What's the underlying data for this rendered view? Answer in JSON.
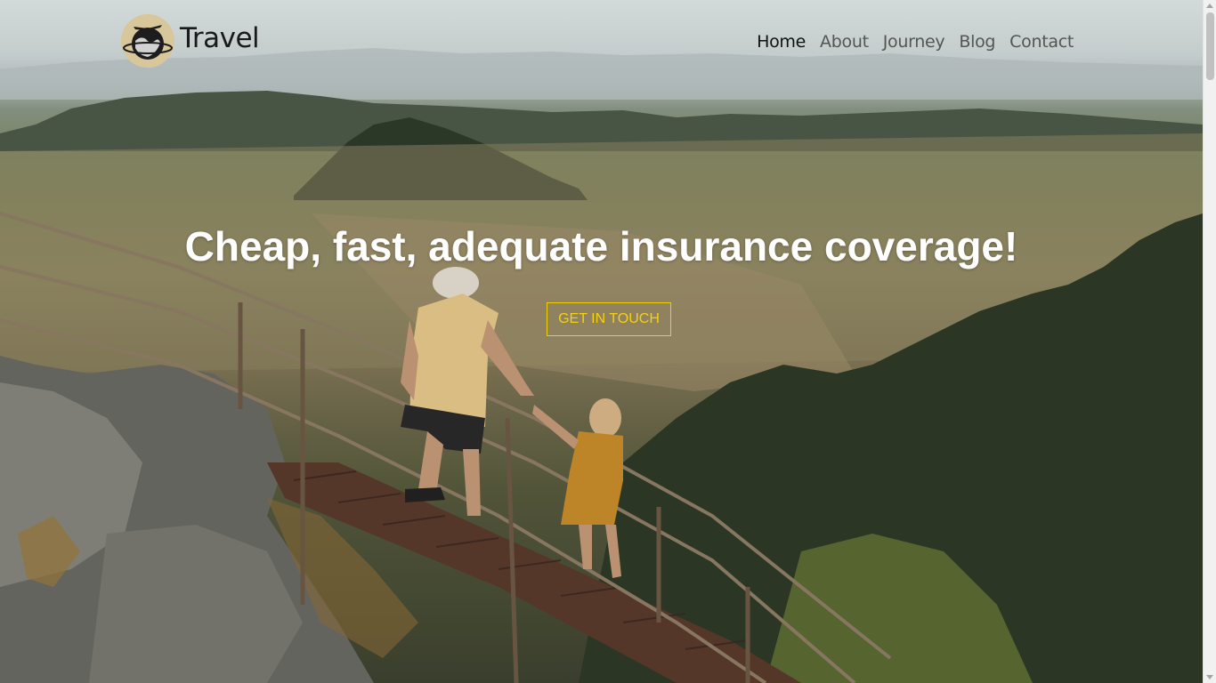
{
  "brand": {
    "name": "Travel",
    "logo_icon": "globe-airplane-icon"
  },
  "nav": {
    "items": [
      {
        "label": "Home",
        "active": true
      },
      {
        "label": "About",
        "active": false
      },
      {
        "label": "Journey",
        "active": false
      },
      {
        "label": "Blog",
        "active": false
      },
      {
        "label": "Contact",
        "active": false
      }
    ]
  },
  "hero": {
    "headline": "Cheap, fast, adequate insurance coverage!",
    "cta_label": "Get in touch",
    "background_image": "couple climbing mountain stairs above valley"
  },
  "colors": {
    "cta_accent": "#f0d000",
    "nav_active": "#111111",
    "nav_inactive": "#555555",
    "headline": "#ffffff"
  }
}
